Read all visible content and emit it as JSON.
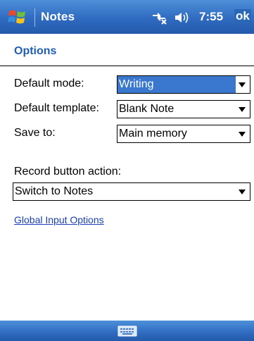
{
  "titlebar": {
    "app_title": "Notes",
    "time": "7:55",
    "ok_label": "ok"
  },
  "page": {
    "title": "Options"
  },
  "form": {
    "default_mode": {
      "label": "Default mode:",
      "value": "Writing"
    },
    "default_template": {
      "label": "Default template:",
      "value": "Blank Note"
    },
    "save_to": {
      "label": "Save to:",
      "value": "Main memory"
    },
    "record_button_action": {
      "label": "Record button action:",
      "value": "Switch to Notes"
    }
  },
  "links": {
    "global_input_options": "Global Input Options"
  },
  "colors": {
    "title_bar": "#2f6bc0",
    "header_text": "#1f5eb4",
    "selection": "#3a78d0",
    "link": "#1a3fb8"
  },
  "icons": {
    "start": "windows-flag-icon",
    "connectivity": "connectivity-icon",
    "volume": "speaker-icon",
    "input": "keyboard-icon"
  }
}
